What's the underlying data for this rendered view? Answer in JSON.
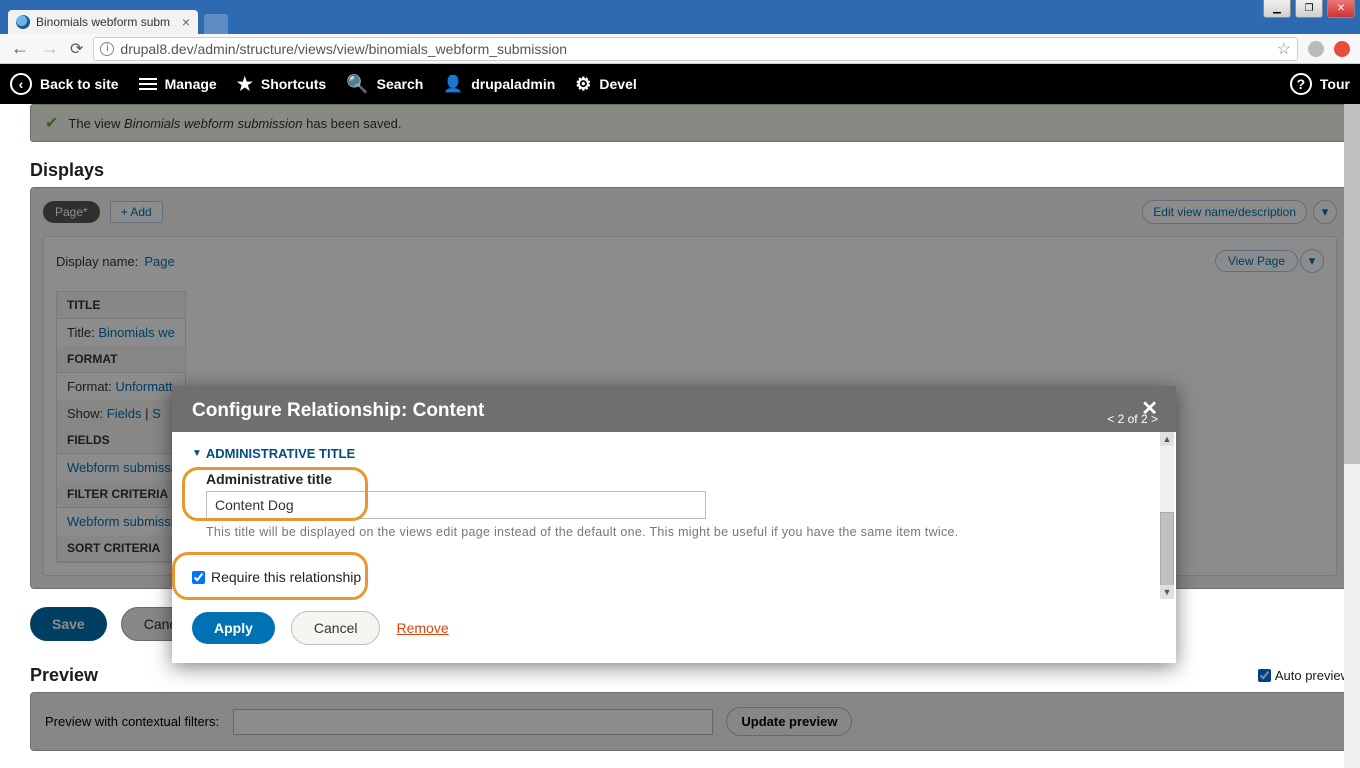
{
  "browser": {
    "tab_title": "Binomials webform subm",
    "url": "drupal8.dev/admin/structure/views/view/binomials_webform_submission"
  },
  "win": {
    "min": "▁",
    "restore": "❐",
    "close": "✕"
  },
  "toolbar": {
    "back": "Back to site",
    "manage": "Manage",
    "shortcuts": "Shortcuts",
    "search": "Search",
    "user": "drupaladmin",
    "devel": "Devel",
    "tour": "Tour"
  },
  "message": {
    "prefix": "The view ",
    "name": "Binomials webform submission",
    "suffix": " has been saved."
  },
  "displays": {
    "heading": "Displays",
    "page_chip": "Page*",
    "add": "+ Add",
    "edit_view": "Edit view name/description",
    "display_name_label": "Display name:",
    "display_name_value": "Page",
    "view_page": "View Page",
    "sections": {
      "title_hdr": "TITLE",
      "title_row_label": "Title:",
      "title_row_value": "Binomials we",
      "format_hdr": "FORMAT",
      "format_row_label": "Format:",
      "format_row_value": "Unformatt",
      "show_row_label": "Show:",
      "show_row_value": "Fields",
      "show_sep": "|",
      "show_s": "S",
      "fields_hdr": "FIELDS",
      "fields_row": "Webform submissi",
      "filter_hdr": "FILTER CRITERIA",
      "filter_row": "Webform submissi",
      "sort_hdr": "SORT CRITERIA"
    }
  },
  "actions": {
    "save": "Save",
    "cancel": "Cancel"
  },
  "preview": {
    "heading": "Preview",
    "auto": "Auto preview",
    "contextual_label": "Preview with contextual filters:",
    "update": "Update preview"
  },
  "modal": {
    "title": "Configure Relationship: Content",
    "pager": "< 2 of 2 >",
    "section": "ADMINISTRATIVE TITLE",
    "field_label": "Administrative title",
    "field_value": "Content Dog",
    "help": "This title will be displayed on the views edit page instead of the default one. This might be useful if you have the same item twice.",
    "require": "Require this relationship",
    "apply": "Apply",
    "cancel": "Cancel",
    "remove": "Remove"
  }
}
